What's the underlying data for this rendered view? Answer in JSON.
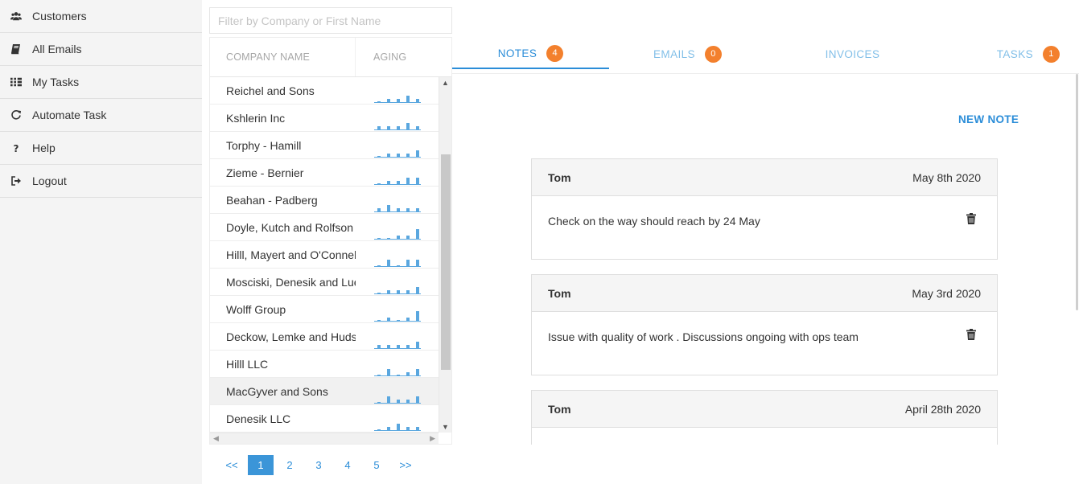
{
  "sidebar": {
    "items": [
      {
        "label": "Customers",
        "icon": "users-icon"
      },
      {
        "label": "All Emails",
        "icon": "book-icon"
      },
      {
        "label": "My Tasks",
        "icon": "tasks-icon"
      },
      {
        "label": "Automate Task",
        "icon": "refresh-icon"
      },
      {
        "label": "Help",
        "icon": "question-icon"
      },
      {
        "label": "Logout",
        "icon": "sign-out-icon"
      }
    ]
  },
  "filter": {
    "placeholder": "Filter by Company or First Name"
  },
  "list": {
    "header_company": "COMPANY NAME",
    "header_aging": "AGING",
    "accent_color": "#5aa7df",
    "companies": [
      {
        "name": "Reichel and Sons",
        "aging": [
          0,
          1,
          1,
          2,
          1
        ]
      },
      {
        "name": "Kshlerin Inc",
        "aging": [
          1,
          1,
          1,
          2,
          1
        ]
      },
      {
        "name": "Torphy - Hamill",
        "aging": [
          0,
          1,
          1,
          1,
          2
        ]
      },
      {
        "name": "Zieme - Bernier",
        "aging": [
          0,
          1,
          1,
          2,
          2
        ]
      },
      {
        "name": "Beahan - Padberg",
        "aging": [
          1,
          2,
          1,
          1,
          1
        ]
      },
      {
        "name": "Doyle, Kutch and Rolfson",
        "aging": [
          0,
          0,
          1,
          1,
          3
        ]
      },
      {
        "name": "Hilll, Mayert and O'Connell",
        "aging": [
          0,
          2,
          0,
          2,
          2
        ]
      },
      {
        "name": "Mosciski, Denesik and Lueilwitz",
        "aging": [
          0,
          1,
          1,
          1,
          2
        ]
      },
      {
        "name": "Wolff Group",
        "aging": [
          0,
          1,
          0,
          1,
          3
        ]
      },
      {
        "name": "Deckow, Lemke and Hudson",
        "aging": [
          1,
          1,
          1,
          1,
          2
        ]
      },
      {
        "name": "Hilll LLC",
        "aging": [
          0,
          2,
          0,
          1,
          2
        ]
      },
      {
        "name": "MacGyver and Sons",
        "aging": [
          0,
          2,
          1,
          1,
          2
        ]
      },
      {
        "name": "Denesik LLC",
        "aging": [
          0,
          1,
          2,
          1,
          1
        ]
      }
    ],
    "selected_index": 11
  },
  "pagination": {
    "first": "<<",
    "pages": [
      "1",
      "2",
      "3",
      "4",
      "5"
    ],
    "last": ">>",
    "current": "1"
  },
  "tabs": [
    {
      "label": "NOTES",
      "badge": "4",
      "active": true
    },
    {
      "label": "EMAILS",
      "badge": "0",
      "active": false
    },
    {
      "label": "INVOICES",
      "badge": "",
      "active": false
    },
    {
      "label": "TASKS",
      "badge": "1",
      "active": false
    }
  ],
  "notes": {
    "new_note_label": "NEW NOTE",
    "items": [
      {
        "author": "Tom",
        "date": "May 8th 2020",
        "text": "Check on the way should reach by 24 May"
      },
      {
        "author": "Tom",
        "date": "May 3rd 2020",
        "text": "Issue with quality of work . Discussions ongoing with ops team"
      },
      {
        "author": "Tom",
        "date": "April 28th 2020",
        "text": ""
      }
    ]
  },
  "colors": {
    "primary": "#2b8dd8",
    "badge": "#f3802d",
    "tab_inactive": "#82bfe8"
  }
}
